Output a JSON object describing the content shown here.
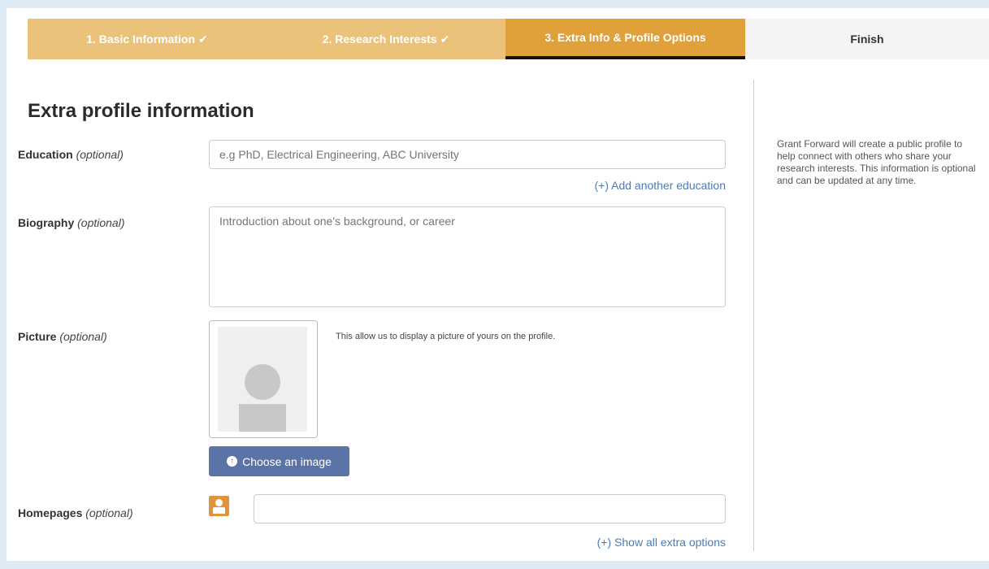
{
  "steps": [
    {
      "label": "1. Basic Information",
      "state": "done"
    },
    {
      "label": "2. Research Interests",
      "state": "done"
    },
    {
      "label": "3. Extra Info & Profile Options",
      "state": "active"
    },
    {
      "label": "Finish",
      "state": "next"
    }
  ],
  "check_glyph": "✔",
  "form": {
    "heading": "Extra profile information",
    "optional": "(optional)",
    "education": {
      "label": "Education",
      "placeholder": "e.g PhD, Electrical Engineering, ABC University",
      "value": "",
      "add_link": "(+) Add another education"
    },
    "biography": {
      "label": "Biography",
      "placeholder": "Introduction about one's background, or career",
      "value": ""
    },
    "picture": {
      "label": "Picture",
      "help": "This allow us to display a picture of yours on the profile.",
      "button": "Choose an image"
    },
    "homepages": {
      "label": "Homepages",
      "value": "",
      "show_link": "(+) Show all extra options"
    }
  },
  "sidebar": {
    "text": "Grant Forward will create a public profile to help connect with others who share your research interests. This information is optional and can be updated at any time."
  },
  "colors": {
    "step_done": "#ebc27a",
    "step_active": "#e0a13a",
    "link": "#4a7ab8",
    "button": "#5b74a8",
    "homepage_icon": "#e0933a"
  }
}
